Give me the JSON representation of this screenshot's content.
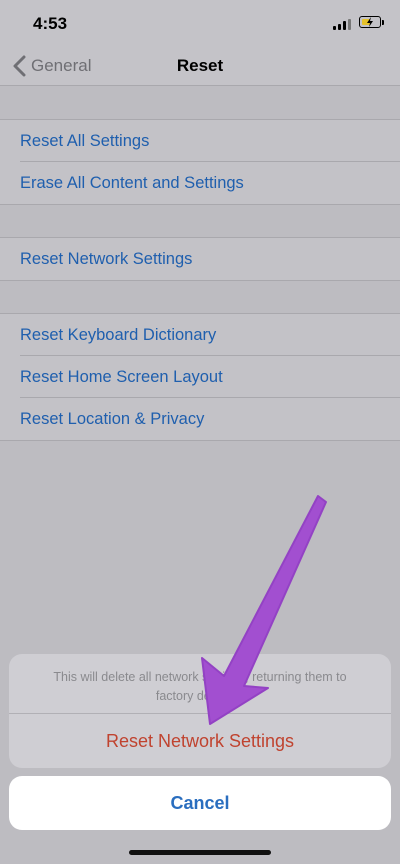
{
  "status_bar": {
    "time": "4:53"
  },
  "nav": {
    "back_label": "General",
    "title": "Reset"
  },
  "groups": [
    {
      "items": [
        "Reset All Settings",
        "Erase All Content and Settings"
      ]
    },
    {
      "items": [
        "Reset Network Settings"
      ]
    },
    {
      "items": [
        "Reset Keyboard Dictionary",
        "Reset Home Screen Layout",
        "Reset Location & Privacy"
      ]
    }
  ],
  "action_sheet": {
    "message": "This will delete all network settings, returning them to factory defaults.",
    "action_label": "Reset Network Settings",
    "cancel_label": "Cancel"
  },
  "colors": {
    "link_blue": "#1f5fae",
    "destructive_red": "#c0432f",
    "annotation_arrow": "#a24fd0",
    "battery_charging": "#e6c22a"
  }
}
